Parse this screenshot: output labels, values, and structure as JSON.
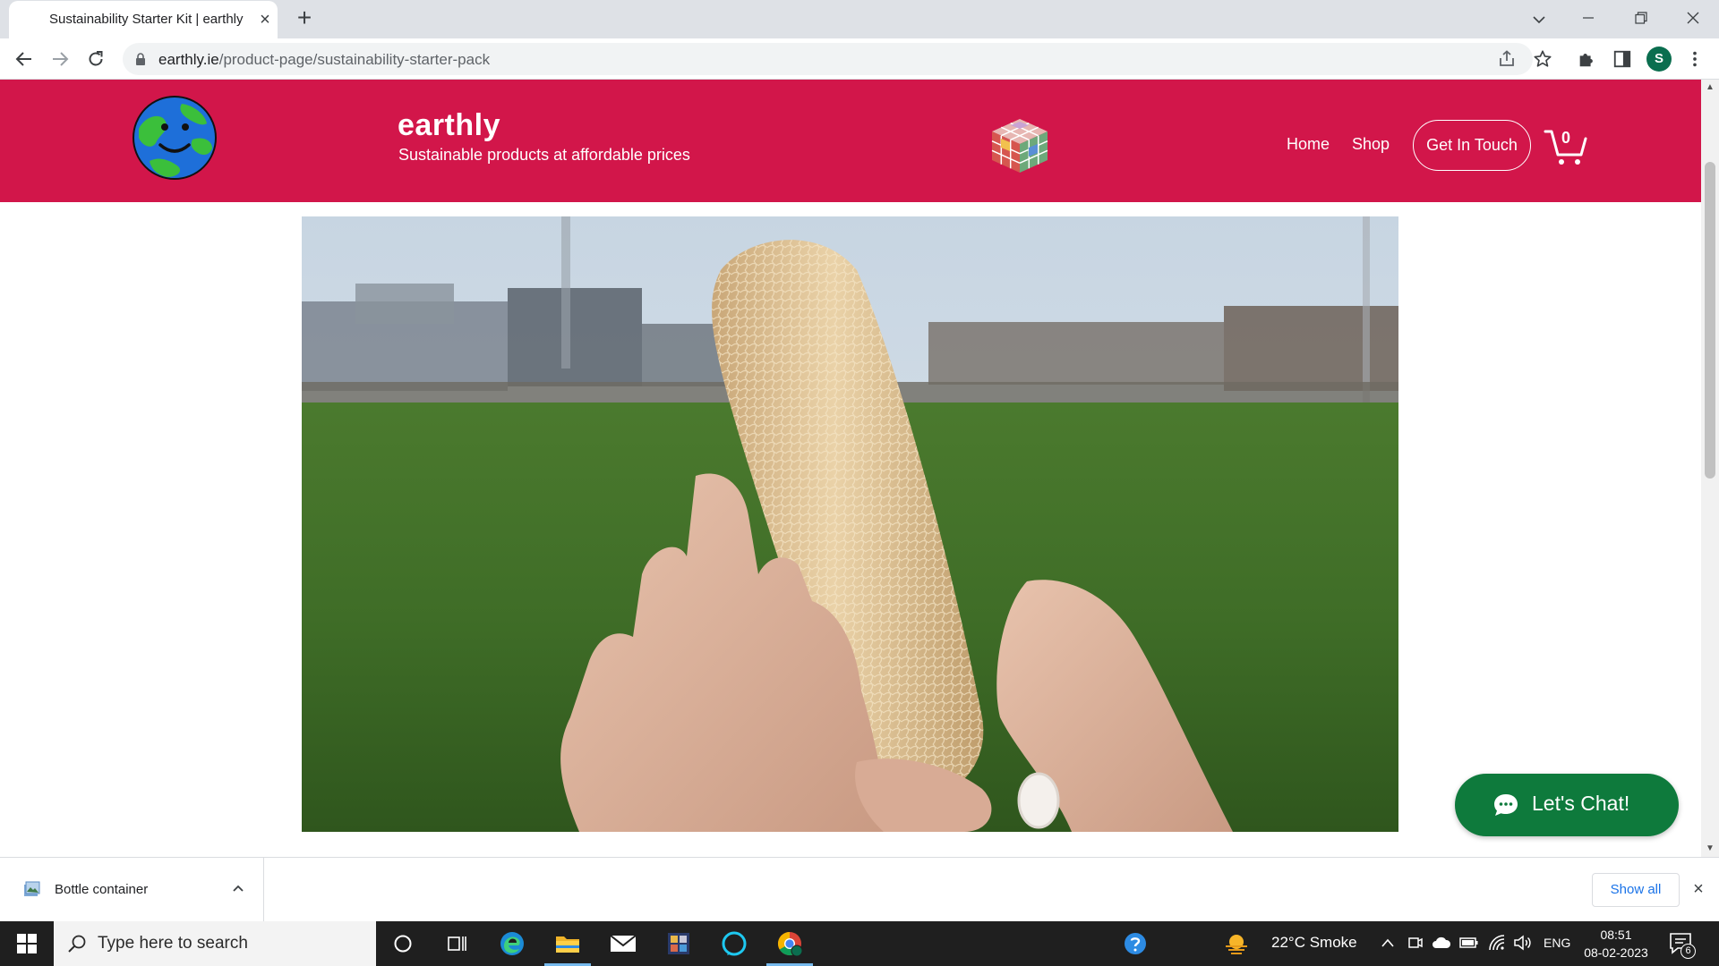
{
  "browser": {
    "tab_title": "Sustainability Starter Kit | earthly",
    "url_host": "earthly.ie",
    "url_path": "/product-page/sustainability-starter-pack",
    "profile_initial": "S"
  },
  "site": {
    "brand": "earthly",
    "tagline": "Sustainable products at affordable prices",
    "nav": {
      "home": "Home",
      "shop": "Shop",
      "contact": "Get In Touch"
    },
    "cart_count": "0",
    "accent_color": "#d2164a"
  },
  "product": {
    "image_icon": "loofah-sponge-photo"
  },
  "chat": {
    "label": "Let's Chat!",
    "color": "#0e7a3c"
  },
  "downloads": {
    "file_name": "Bottle container",
    "show_all": "Show all"
  },
  "taskbar": {
    "search_placeholder": "Type here to search",
    "weather": "22°C  Smoke",
    "language": "ENG",
    "time": "08:51",
    "date": "08-02-2023",
    "notification_count": "6"
  }
}
